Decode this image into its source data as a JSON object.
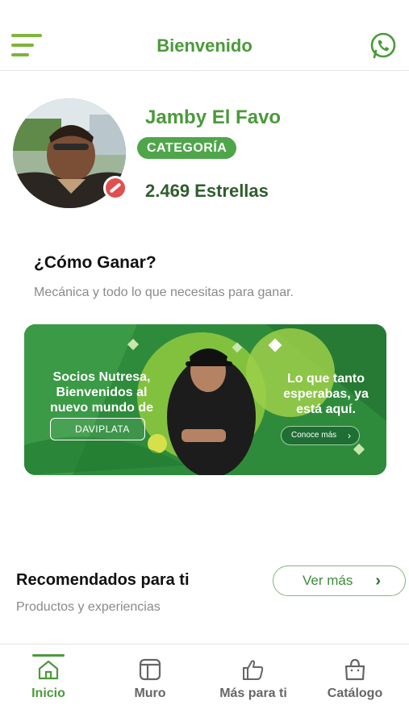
{
  "header": {
    "title": "Bienvenido"
  },
  "profile": {
    "name": "Jamby El Favo",
    "category": "CATEGORÍA",
    "stars": "2.469 Estrellas"
  },
  "how_to_win": {
    "title": "¿Cómo Ganar?",
    "subtitle": "Mecánica y todo lo que necesitas para ganar."
  },
  "banner": {
    "left_text": "Socios Nutresa, Bienvenidos al nuevo mundo de",
    "logo_text": "DAVIPLATA",
    "right_text": "Lo que tanto esperabas, ya está aquí.",
    "button_label": "Conoce más"
  },
  "recommended": {
    "title": "Recomendados para ti",
    "subtitle": "Productos y experiencias",
    "see_more_label": "Ver más"
  },
  "tabs": [
    {
      "label": "Inicio",
      "icon": "home-icon",
      "active": true
    },
    {
      "label": "Muro",
      "icon": "wall-icon",
      "active": false
    },
    {
      "label": "Más para ti",
      "icon": "thumbs-up-icon",
      "active": false
    },
    {
      "label": "Catálogo",
      "icon": "bag-icon",
      "active": false
    }
  ],
  "colors": {
    "brand_green": "#4a9a3a",
    "accent_green": "#7db53b",
    "badge_green": "#4fa64a",
    "banner_green": "#2f8a3a"
  }
}
